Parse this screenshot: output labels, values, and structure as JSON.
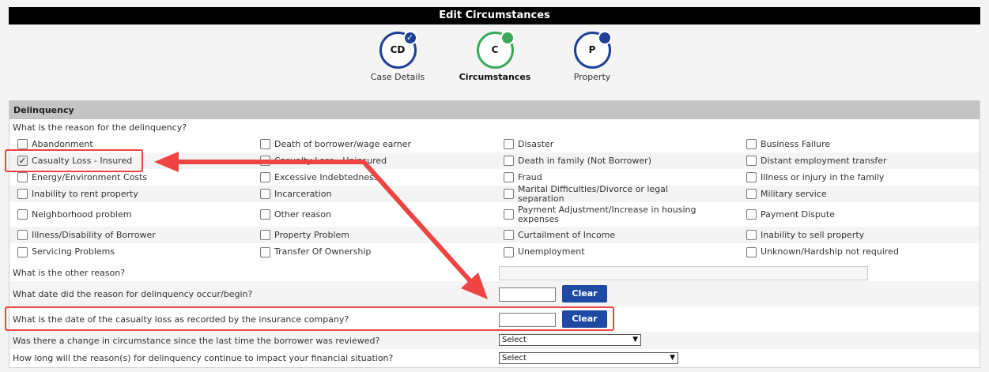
{
  "title": "Edit Circumstances",
  "steps": [
    {
      "abbr": "CD",
      "label": "Case Details",
      "status_icon": "check-icon"
    },
    {
      "abbr": "C",
      "label": "Circumstances",
      "status_icon": "in-progress-dot-icon"
    },
    {
      "abbr": "P",
      "label": "Property",
      "status_icon": "pending-dot-icon"
    }
  ],
  "colors": {
    "complete": "#1f3f99",
    "in_progress": "#3aaa5a",
    "pending": "#1f3f99",
    "button": "#1f4aa3",
    "annotation": "#ee4444"
  },
  "section": {
    "header": "Delinquency",
    "question": "What is the reason for the delinquency?"
  },
  "reasons": [
    [
      "Abandonment",
      "Death of borrower/wage earner",
      "Disaster",
      "Business Failure"
    ],
    [
      "Casualty Loss - Insured",
      "Casualty Loss - Uninsured",
      "Death in family (Not Borrower)",
      "Distant employment transfer"
    ],
    [
      "Energy/Environment Costs",
      "Excessive Indebtedness",
      "Fraud",
      "Illness or injury in the family"
    ],
    [
      "Inability to rent property",
      "Incarceration",
      "Marital Difficulties/Divorce or legal separation",
      "Military service"
    ],
    [
      "Neighborhood problem",
      "Other reason",
      "Payment Adjustment/Increase in housing expenses",
      "Payment Dispute"
    ],
    [
      "Illness/Disability of Borrower",
      "Property Problem",
      "Curtailment of Income",
      "Inability to sell property"
    ],
    [
      "Servicing Problems",
      "Transfer Of Ownership",
      "Unemployment",
      "Unknown/Hardship not required"
    ]
  ],
  "checked_reason": "Casualty Loss - Insured",
  "questions": {
    "other_reason": "What is the other reason?",
    "reason_date": "What date did the reason for delinquency occur/begin?",
    "casualty_date": "What is the date of the casualty loss as recorded by the insurance company?",
    "change": "Was there a change in circumstance since the last time the borrower was reviewed?",
    "duration": "How long will the reason(s) for delinquency continue to impact your financial situation?"
  },
  "inputs": {
    "other_reason": "",
    "reason_date": "",
    "casualty_date": ""
  },
  "buttons": {
    "clear": "Clear"
  },
  "selects": {
    "change": "Select",
    "duration": "Select"
  }
}
